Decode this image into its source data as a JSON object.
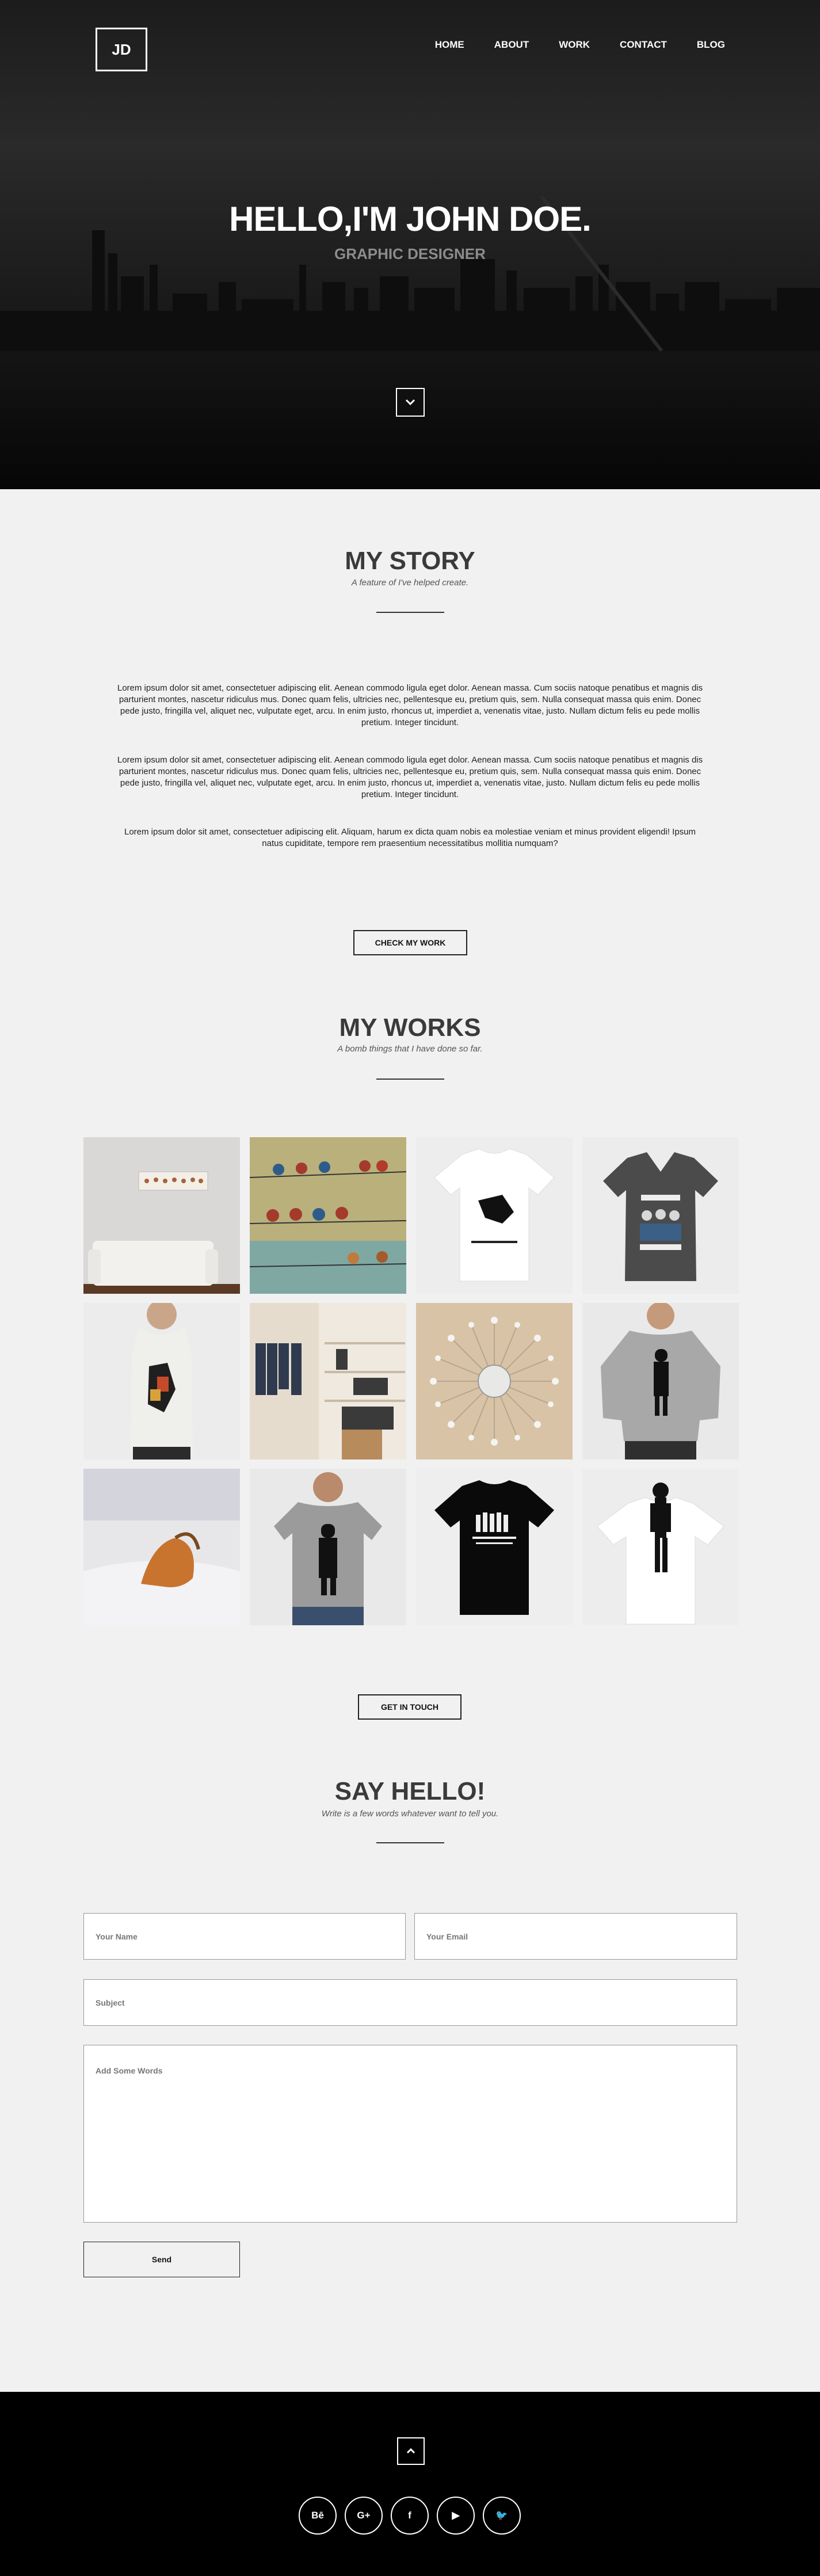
{
  "header": {
    "logo": "JD",
    "nav": [
      "HOME",
      "ABOUT",
      "WORK",
      "CONTACT",
      "BLOG"
    ]
  },
  "hero": {
    "title": "HELLO,I'M JOHN DOE.",
    "subtitle": "GRAPHIC DESIGNER",
    "scroll_icon": "chevron-down-icon"
  },
  "story": {
    "title": "MY STORY",
    "subtitle": "A feature of I've helped create.",
    "paragraphs": [
      "Lorem ipsum dolor sit amet, consectetuer adipiscing elit. Aenean commodo ligula eget dolor. Aenean massa. Cum sociis natoque penatibus et magnis dis parturient montes, nascetur ridiculus mus. Donec quam felis, ultricies nec, pellentesque eu, pretium quis, sem. Nulla consequat massa quis enim. Donec pede justo, fringilla vel, aliquet nec, vulputate eget, arcu. In enim justo, rhoncus ut, imperdiet a, venenatis vitae, justo. Nullam dictum felis eu pede mollis pretium. Integer tincidunt.",
      "Lorem ipsum dolor sit amet, consectetuer adipiscing elit. Aenean commodo ligula eget dolor. Aenean massa. Cum sociis natoque penatibus et magnis dis parturient montes, nascetur ridiculus mus. Donec quam felis, ultricies nec, pellentesque eu, pretium quis, sem. Nulla consequat massa quis enim. Donec pede justo, fringilla vel, aliquet nec, vulputate eget, arcu. In enim justo, rhoncus ut, imperdiet a, venenatis vitae, justo. Nullam dictum felis eu pede mollis pretium. Integer tincidunt.",
      "Lorem ipsum dolor sit amet, consectetuer adipiscing elit. Aliquam, harum ex dicta quam nobis ea molestiae veniam et minus provident eligendi! Ipsum natus cupiditate, tempore rem praesentium necessitatibus mollitia numquam?"
    ],
    "button": "CHECK MY WORK"
  },
  "works": {
    "title": "MY WORKS",
    "subtitle": "A bomb things that I have done so far.",
    "button": "GET IN TOUCH"
  },
  "contact": {
    "title": "SAY HELLO!",
    "subtitle": "Write is a few words whatever want to tell you.",
    "name_placeholder": "Your Name",
    "email_placeholder": "Your Email",
    "subject_placeholder": "Subject",
    "message_placeholder": "Add Some Words",
    "send": "Send"
  },
  "footer": {
    "up_icon": "chevron-up-icon",
    "social": [
      "Bē",
      "G+",
      "f",
      "▶",
      "🐦"
    ]
  }
}
